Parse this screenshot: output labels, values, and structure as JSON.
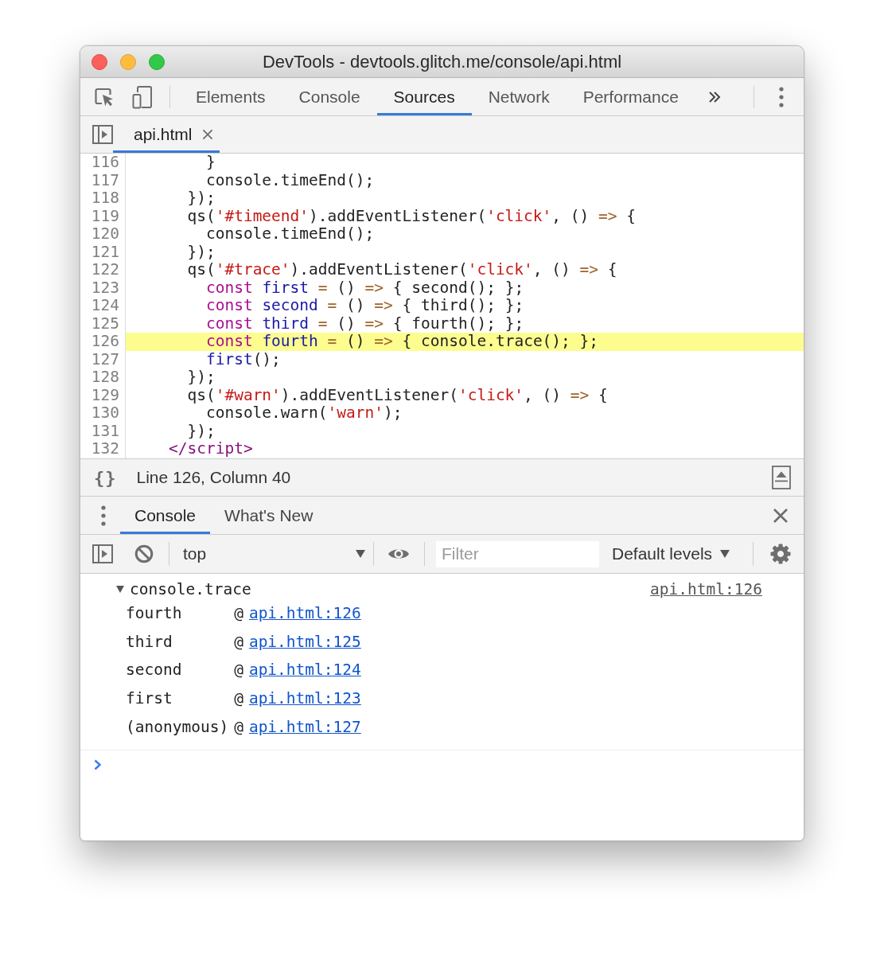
{
  "window": {
    "title": "DevTools - devtools.glitch.me/console/api.html"
  },
  "toolbar": {
    "tabs": [
      {
        "label": "Elements",
        "selected": false
      },
      {
        "label": "Console",
        "selected": false
      },
      {
        "label": "Sources",
        "selected": true
      },
      {
        "label": "Network",
        "selected": false
      },
      {
        "label": "Performance",
        "selected": false
      }
    ]
  },
  "editor": {
    "tabs": [
      {
        "label": "api.html",
        "selected": true
      }
    ],
    "lines": [
      {
        "number": "116",
        "highlighted": false,
        "tokens": [
          {
            "text": "        }",
            "kind": "plain"
          }
        ]
      },
      {
        "number": "117",
        "highlighted": false,
        "tokens": [
          {
            "text": "        console.timeEnd();",
            "kind": "plain"
          }
        ]
      },
      {
        "number": "118",
        "highlighted": false,
        "tokens": [
          {
            "text": "      });",
            "kind": "plain"
          }
        ]
      },
      {
        "number": "119",
        "highlighted": false,
        "tokens": [
          {
            "text": "      qs(",
            "kind": "plain"
          },
          {
            "text": "'#timeend'",
            "kind": "string"
          },
          {
            "text": ").addEventListener(",
            "kind": "plain"
          },
          {
            "text": "'click'",
            "kind": "string"
          },
          {
            "text": ", () ",
            "kind": "plain"
          },
          {
            "text": "=>",
            "kind": "operator"
          },
          {
            "text": " {",
            "kind": "plain"
          }
        ]
      },
      {
        "number": "120",
        "highlighted": false,
        "tokens": [
          {
            "text": "        console.timeEnd();",
            "kind": "plain"
          }
        ]
      },
      {
        "number": "121",
        "highlighted": false,
        "tokens": [
          {
            "text": "      });",
            "kind": "plain"
          }
        ]
      },
      {
        "number": "122",
        "highlighted": false,
        "tokens": [
          {
            "text": "      qs(",
            "kind": "plain"
          },
          {
            "text": "'#trace'",
            "kind": "string"
          },
          {
            "text": ").addEventListener(",
            "kind": "plain"
          },
          {
            "text": "'click'",
            "kind": "string"
          },
          {
            "text": ", () ",
            "kind": "plain"
          },
          {
            "text": "=>",
            "kind": "operator"
          },
          {
            "text": " {",
            "kind": "plain"
          }
        ]
      },
      {
        "number": "123",
        "highlighted": false,
        "tokens": [
          {
            "text": "        const ",
            "kind": "keyword"
          },
          {
            "text": "first",
            "kind": "def"
          },
          {
            "text": " = ",
            "kind": "operator"
          },
          {
            "text": "() ",
            "kind": "plain"
          },
          {
            "text": "=>",
            "kind": "operator"
          },
          {
            "text": " { second(); };",
            "kind": "plain"
          }
        ]
      },
      {
        "number": "124",
        "highlighted": false,
        "tokens": [
          {
            "text": "        const ",
            "kind": "keyword"
          },
          {
            "text": "second",
            "kind": "def"
          },
          {
            "text": " = ",
            "kind": "operator"
          },
          {
            "text": "() ",
            "kind": "plain"
          },
          {
            "text": "=>",
            "kind": "operator"
          },
          {
            "text": " { third(); };",
            "kind": "plain"
          }
        ]
      },
      {
        "number": "125",
        "highlighted": false,
        "tokens": [
          {
            "text": "        const ",
            "kind": "keyword"
          },
          {
            "text": "third",
            "kind": "def"
          },
          {
            "text": " = ",
            "kind": "operator"
          },
          {
            "text": "() ",
            "kind": "plain"
          },
          {
            "text": "=>",
            "kind": "operator"
          },
          {
            "text": " { fourth(); };",
            "kind": "plain"
          }
        ]
      },
      {
        "number": "126",
        "highlighted": true,
        "tokens": [
          {
            "text": "        const ",
            "kind": "keyword"
          },
          {
            "text": "fourth",
            "kind": "def"
          },
          {
            "text": " = ",
            "kind": "operator"
          },
          {
            "text": "() ",
            "kind": "plain"
          },
          {
            "text": "=>",
            "kind": "operator"
          },
          {
            "text": " { console.trace(); };",
            "kind": "plain"
          }
        ]
      },
      {
        "number": "127",
        "highlighted": false,
        "tokens": [
          {
            "text": "        first",
            "kind": "def"
          },
          {
            "text": "();",
            "kind": "plain"
          }
        ]
      },
      {
        "number": "128",
        "highlighted": false,
        "tokens": [
          {
            "text": "      });",
            "kind": "plain"
          }
        ]
      },
      {
        "number": "129",
        "highlighted": false,
        "tokens": [
          {
            "text": "      qs(",
            "kind": "plain"
          },
          {
            "text": "'#warn'",
            "kind": "string"
          },
          {
            "text": ").addEventListener(",
            "kind": "plain"
          },
          {
            "text": "'click'",
            "kind": "string"
          },
          {
            "text": ", () ",
            "kind": "plain"
          },
          {
            "text": "=>",
            "kind": "operator"
          },
          {
            "text": " {",
            "kind": "plain"
          }
        ]
      },
      {
        "number": "130",
        "highlighted": false,
        "tokens": [
          {
            "text": "        console.warn(",
            "kind": "plain"
          },
          {
            "text": "'warn'",
            "kind": "string"
          },
          {
            "text": ");",
            "kind": "plain"
          }
        ]
      },
      {
        "number": "131",
        "highlighted": false,
        "tokens": [
          {
            "text": "      });",
            "kind": "plain"
          }
        ]
      },
      {
        "number": "132",
        "highlighted": false,
        "tokens": [
          {
            "text": "    </script>",
            "kind": "tag"
          }
        ]
      }
    ]
  },
  "status_bar": {
    "format_button": "{}",
    "position": "Line 126, Column 40"
  },
  "drawer": {
    "tabs": [
      {
        "label": "Console",
        "selected": true
      },
      {
        "label": "What's New",
        "selected": false
      }
    ]
  },
  "console_toolbar": {
    "context": "top",
    "filter": {
      "placeholder": "Filter"
    },
    "levels": "Default levels"
  },
  "console": {
    "messages": [
      {
        "text": "console.trace",
        "expanded": true,
        "source": "api.html:126",
        "frames": [
          {
            "function": "fourth",
            "at": "@",
            "location": "api.html:126"
          },
          {
            "function": "third",
            "at": "@",
            "location": "api.html:125"
          },
          {
            "function": "second",
            "at": "@",
            "location": "api.html:124"
          },
          {
            "function": "first",
            "at": "@",
            "location": "api.html:123"
          },
          {
            "function": "(anonymous)",
            "at": "@",
            "location": "api.html:127"
          }
        ]
      }
    ]
  }
}
